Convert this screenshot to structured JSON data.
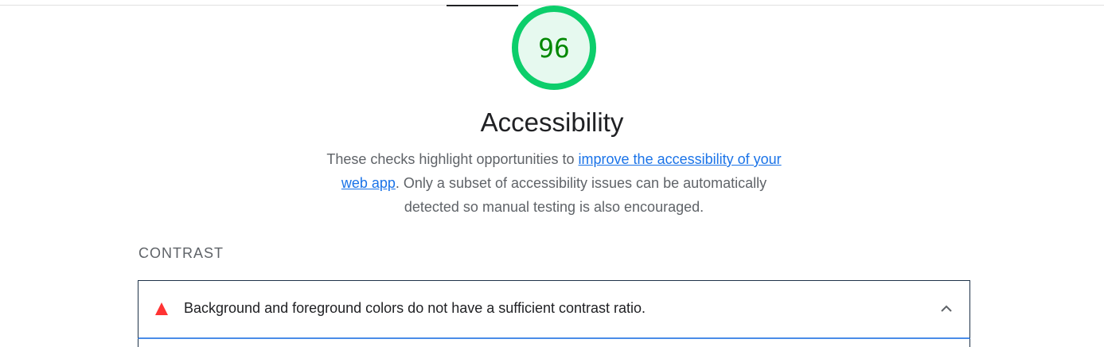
{
  "score": {
    "value": "96",
    "color": "#0cce6b",
    "text_color": "#008800",
    "fill_color": "#e6f9ef"
  },
  "category": {
    "title": "Accessibility",
    "description_before": "These checks highlight opportunities to ",
    "description_link": "improve the accessibility of your web app",
    "description_after": ". Only a subset of accessibility issues can be automatically detected so manual testing is also encouraged."
  },
  "group": {
    "title": "CONTRAST"
  },
  "audit": {
    "status_icon": "fail-triangle-icon",
    "status_color": "#ff3333",
    "text": "Background and foreground colors do not have a sufficient contrast ratio.",
    "expand_icon": "chevron-up-icon"
  }
}
